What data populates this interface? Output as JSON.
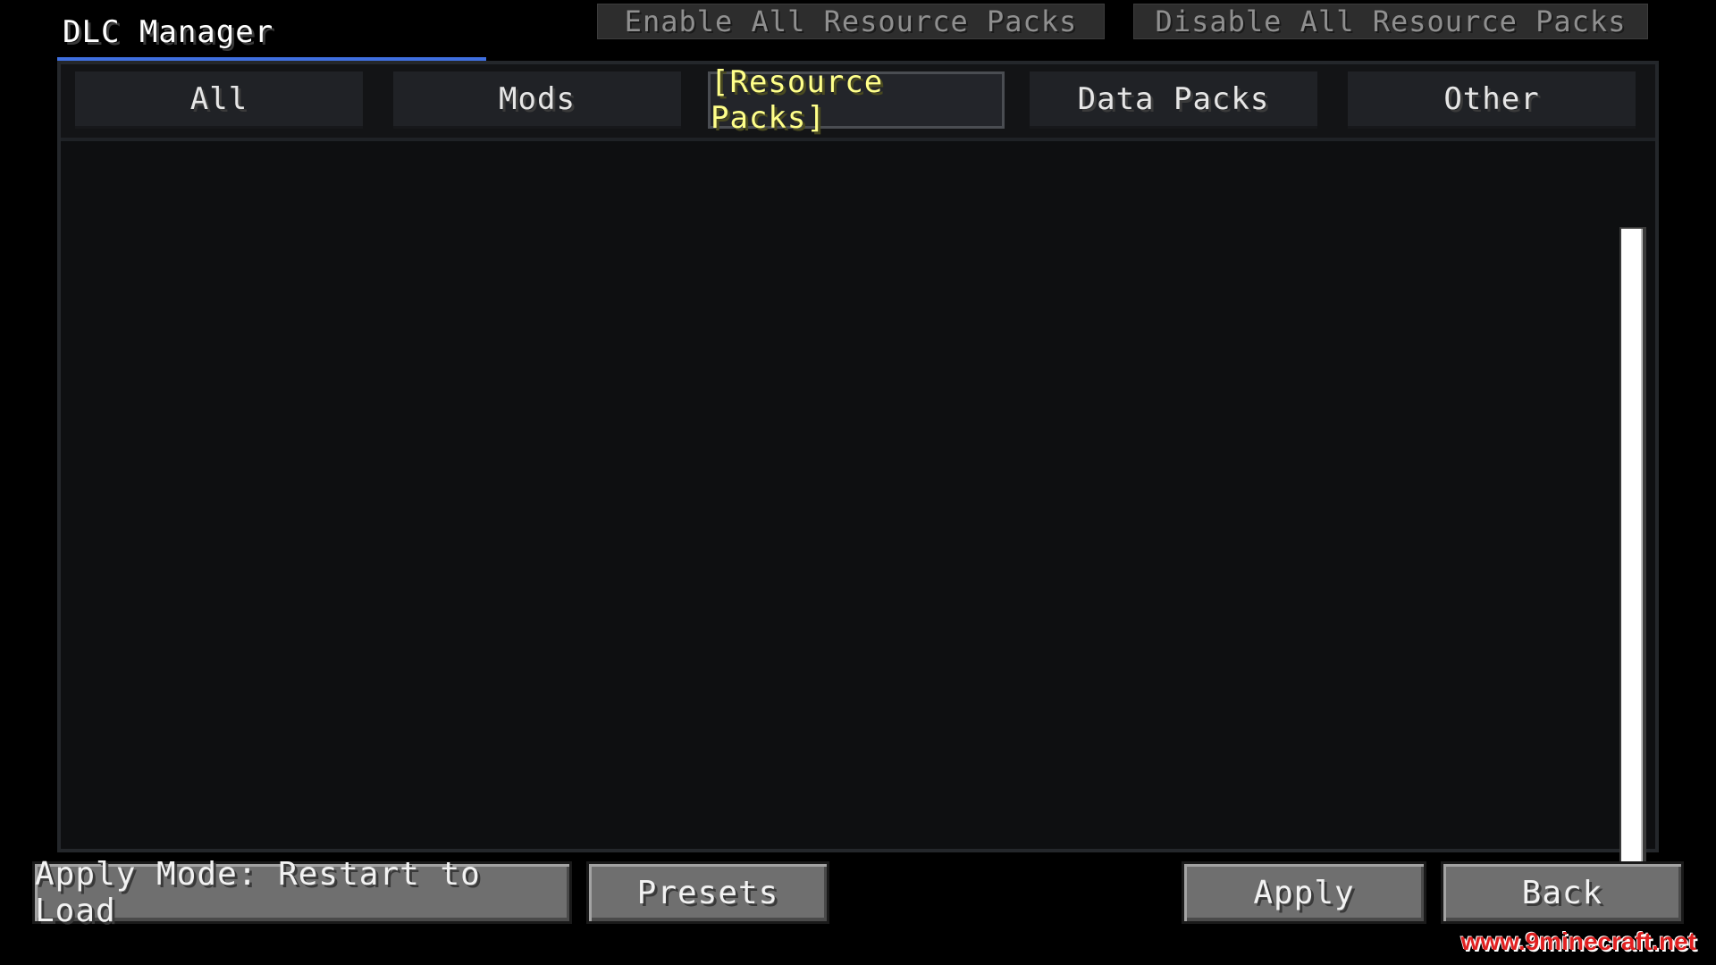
{
  "header": {
    "title": "DLC Manager",
    "enable_all_label": "Enable All Resource Packs",
    "disable_all_label": "Disable All Resource Packs"
  },
  "tabs": [
    {
      "label": "All",
      "selected": false
    },
    {
      "label": "Mods",
      "selected": false
    },
    {
      "label": "[Resource Packs]",
      "selected": true
    },
    {
      "label": "Data Packs",
      "selected": false
    },
    {
      "label": "Other",
      "selected": false
    }
  ],
  "footer": {
    "apply_mode_label": "Apply Mode: Restart to Load",
    "presets_label": "Presets",
    "apply_label": "Apply",
    "back_label": "Back"
  },
  "watermark": "www.9minecraft.net",
  "colors": {
    "accent": "#3f6fe0",
    "selected_tab_text": "#ffff8a",
    "watermark": "#e02020"
  }
}
